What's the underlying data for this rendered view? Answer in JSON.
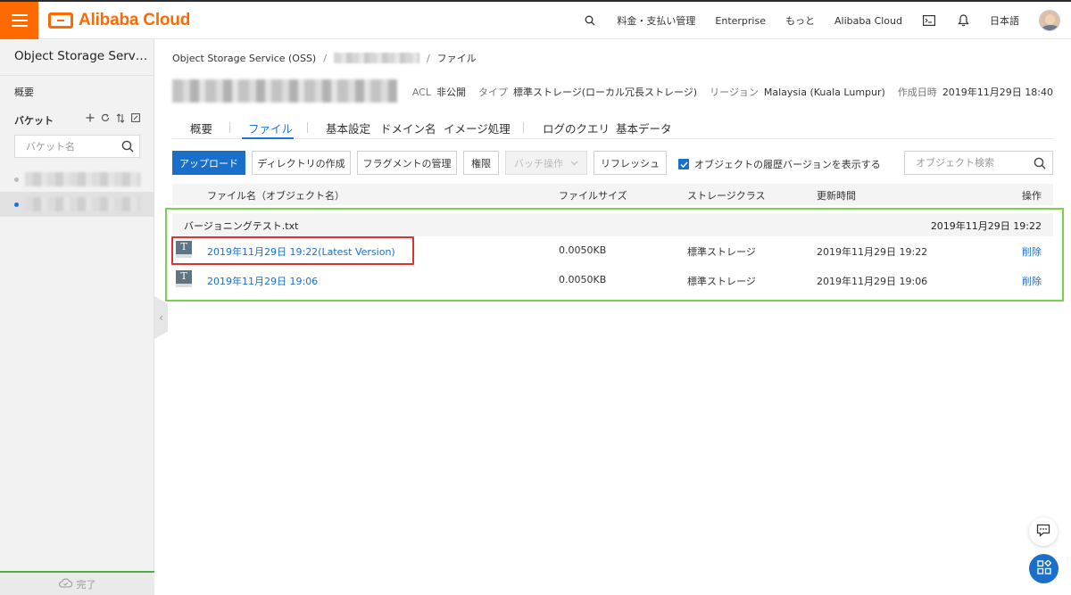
{
  "topbar": {
    "brand": "Alibaba Cloud",
    "items": [
      "料金・支払い管理",
      "Enterprise",
      "もっと",
      "Alibaba Cloud"
    ],
    "language": "日本語",
    "icons": [
      "search-icon",
      "terminal-icon",
      "bell-icon",
      "avatar"
    ]
  },
  "sidebar": {
    "title": "Object Storage Servic…",
    "overview": "概要",
    "bucket_label": "バケット",
    "bucket_search_placeholder": "バケット名",
    "footer": "完了"
  },
  "breadcrumb": {
    "root": "Object Storage Service (OSS)",
    "current": "ファイル"
  },
  "meta": {
    "acl_label": "ACL",
    "acl_value": "非公開",
    "type_label": "タイプ",
    "type_value": "標準ストレージ(ローカル冗長ストレージ)",
    "region_label": "リージョン",
    "region_value": "Malaysia (Kuala Lumpur)",
    "created_label": "作成日時",
    "created_value": "2019年11月29日 18:40"
  },
  "tabs": [
    "概要",
    "ファイル",
    "基本設定",
    "ドメイン名",
    "イメージ処理",
    "ログのクエリ",
    "基本データ"
  ],
  "toolbar": {
    "upload": "アップロード",
    "create_dir": "ディレクトリの作成",
    "fragments": "フラグメントの管理",
    "permission": "権限",
    "batch": "バッチ操作",
    "refresh": "リフレッシュ",
    "show_versions": "オブジェクトの履歴バージョンを表示する",
    "search_placeholder": "オブジェクト検索"
  },
  "table": {
    "headers": [
      "ファイル名（オブジェクト名）",
      "ファイルサイズ",
      "ストレージクラス",
      "更新時間",
      "操作"
    ],
    "group": {
      "name": "バージョニングテスト.txt",
      "date": "2019年11月29日 19:22"
    },
    "rows": [
      {
        "name": "2019年11月29日 19:22(Latest Version)",
        "size": "0.0050KB",
        "class": "標準ストレージ",
        "updated": "2019年11月29日 19:22",
        "action": "削除"
      },
      {
        "name": "2019年11月29日 19:06",
        "size": "0.0050KB",
        "class": "標準ストレージ",
        "updated": "2019年11月29日 19:06",
        "action": "削除"
      }
    ]
  },
  "file_icon_letter": "T",
  "colors": {
    "brand": "#ff6a00",
    "primary": "#1a6fc9",
    "highlight_green": "#7bd14c",
    "highlight_red": "#e03030"
  }
}
